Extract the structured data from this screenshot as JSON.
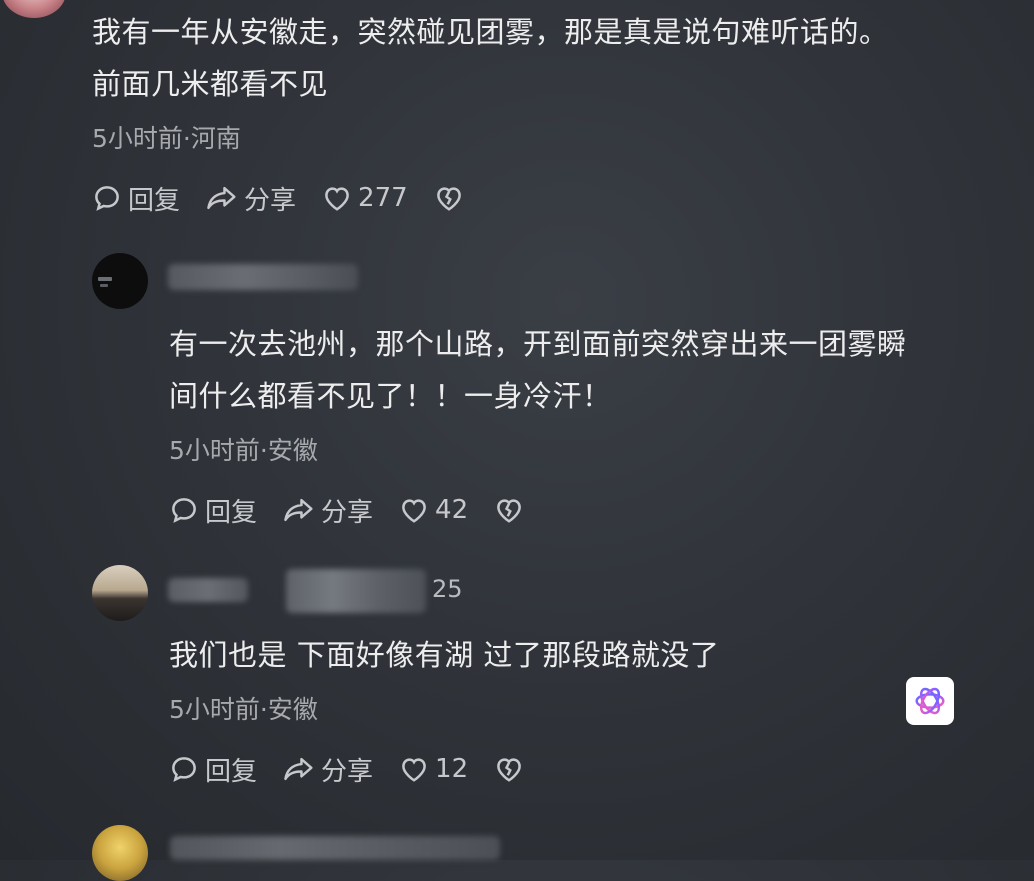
{
  "top_comment": {
    "text_line1": "我有一年从安徽走，突然碰见团雾，那是真是说句难听话的。",
    "text_line2": "前面几米都看不见",
    "meta": "5小时前·河南",
    "reply_label": "回复",
    "share_label": "分享",
    "like_count": "277"
  },
  "reply_1": {
    "username_partial": "",
    "text_line1": "有一次去池州，那个山路，开到面前突然穿出来一团雾瞬",
    "text_line2": "间什么都看不见了！！一身冷汗！",
    "meta": "5小时前·安徽",
    "reply_label": "回复",
    "share_label": "分享",
    "like_count": "42"
  },
  "reply_2": {
    "username_partial": "25",
    "text_line1": "我们也是 下面好像有湖 过了那段路就没了",
    "meta": "5小时前·安徽",
    "reply_label": "回复",
    "share_label": "分享",
    "like_count": "12"
  },
  "icons": {
    "reply": "comment-bubble-icon",
    "share": "share-arrow-icon",
    "like": "heart-icon",
    "dislike": "broken-heart-icon",
    "ai": "ai-assistant-icon"
  },
  "colors": {
    "background": "#30343a",
    "text": "#ededee",
    "meta": "#a7a9ad",
    "action": "#c6c8cb"
  }
}
